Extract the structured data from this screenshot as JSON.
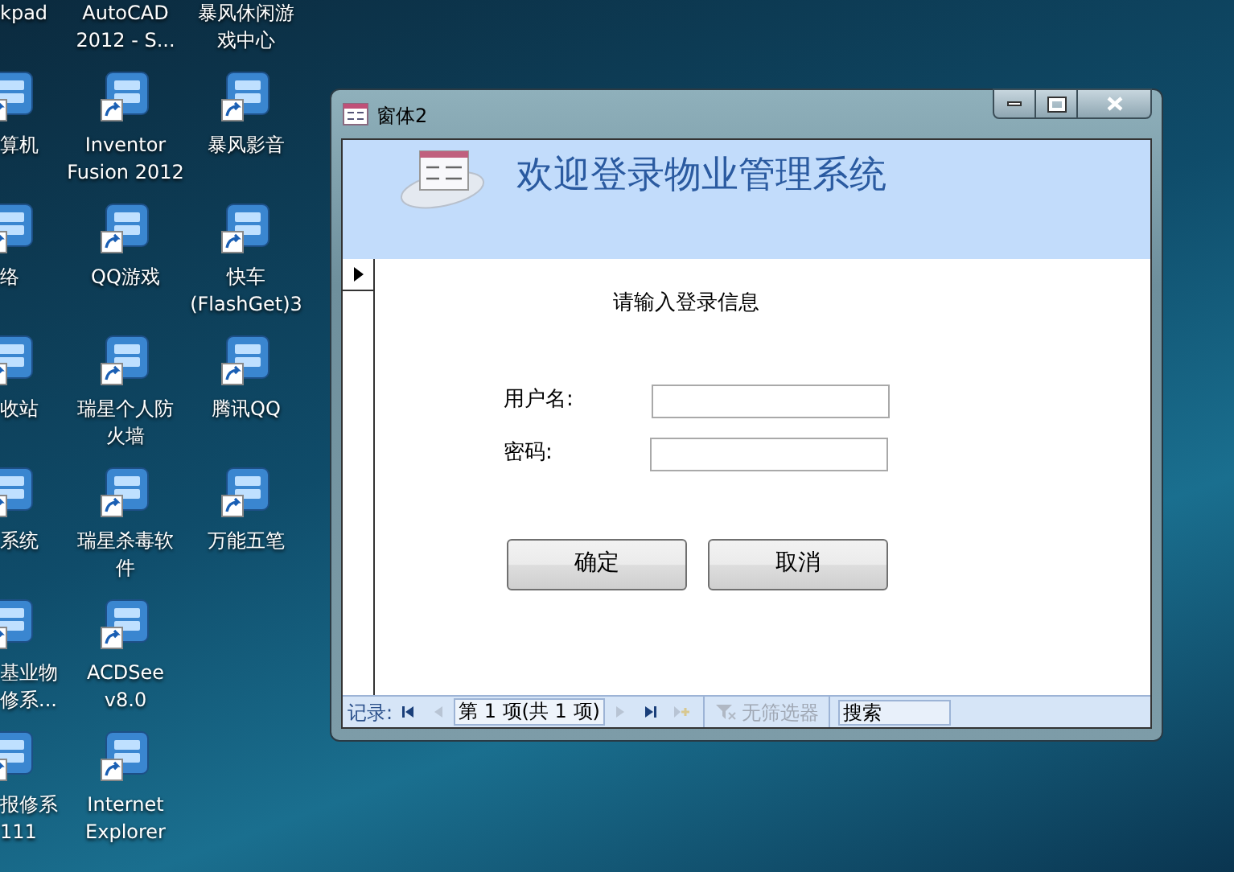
{
  "desktop_columns": [
    [
      {
        "lines": [
          "kpad"
        ]
      },
      {
        "lines": [
          "算机"
        ]
      },
      {
        "lines": [
          "络"
        ]
      },
      {
        "lines": [
          "收站"
        ]
      },
      {
        "lines": [
          "系统"
        ]
      },
      {
        "lines": [
          "基业物",
          "修系..."
        ]
      },
      {
        "lines": [
          "报修系",
          "111"
        ]
      }
    ],
    [
      {
        "lines": [
          "AutoCAD",
          "2012 - S..."
        ]
      },
      {
        "lines": [
          "Inventor",
          "Fusion 2012"
        ]
      },
      {
        "lines": [
          "QQ游戏"
        ]
      },
      {
        "lines": [
          "瑞星个人防",
          "火墙"
        ]
      },
      {
        "lines": [
          "瑞星杀毒软",
          "件"
        ]
      },
      {
        "lines": [
          "ACDSee",
          "v8.0"
        ]
      },
      {
        "lines": [
          "Internet",
          "Explorer"
        ]
      }
    ],
    [
      {
        "lines": [
          "暴风休闲游",
          "戏中心"
        ]
      },
      {
        "lines": [
          "暴风影音"
        ]
      },
      {
        "lines": [
          "快车",
          "(FlashGet)3"
        ]
      },
      {
        "lines": [
          "腾讯QQ"
        ]
      },
      {
        "lines": [
          "万能五笔"
        ]
      }
    ]
  ],
  "window": {
    "title": "窗体2",
    "form": {
      "heading": "欢迎登录物业管理系统",
      "prompt": "请输入登录信息",
      "fields": [
        {
          "label": "用户名:"
        },
        {
          "label": "密码:"
        }
      ],
      "buttons": [
        "确定",
        "取消"
      ]
    },
    "record_nav": {
      "label": "记录:",
      "position": "第 1 项(共 1 项)",
      "buttons": [
        {
          "kind": "first",
          "disabled": false
        },
        {
          "kind": "prev",
          "disabled": true
        },
        {
          "kind": "next",
          "disabled": true
        },
        {
          "kind": "last",
          "disabled": false
        },
        {
          "kind": "new",
          "disabled": true
        }
      ],
      "filter": {
        "label": "无筛选器",
        "disabled": true
      },
      "search": {
        "placeholder": "搜索"
      }
    }
  }
}
